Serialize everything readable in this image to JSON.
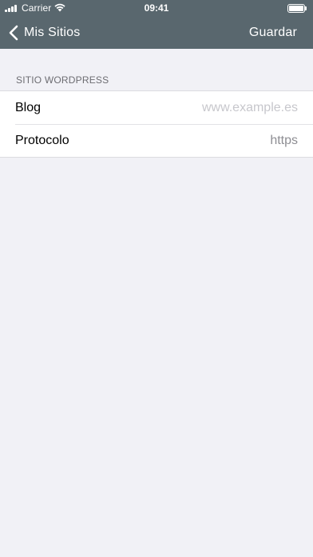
{
  "status_bar": {
    "carrier": "Carrier",
    "time": "09:41"
  },
  "nav": {
    "back_label": "Mis Sitios",
    "save_label": "Guardar"
  },
  "section": {
    "header": "SITIO WORDPRESS",
    "rows": [
      {
        "label": "Blog",
        "placeholder": "www.example.es",
        "value": ""
      },
      {
        "label": "Protocolo",
        "value": "https"
      }
    ]
  },
  "colors": {
    "nav_background": "#59676e",
    "page_background": "#f1f1f6"
  },
  "icons": {
    "back": "chevron-left-icon",
    "wifi": "wifi-icon",
    "battery": "battery-icon",
    "signal": "signal-icon"
  }
}
